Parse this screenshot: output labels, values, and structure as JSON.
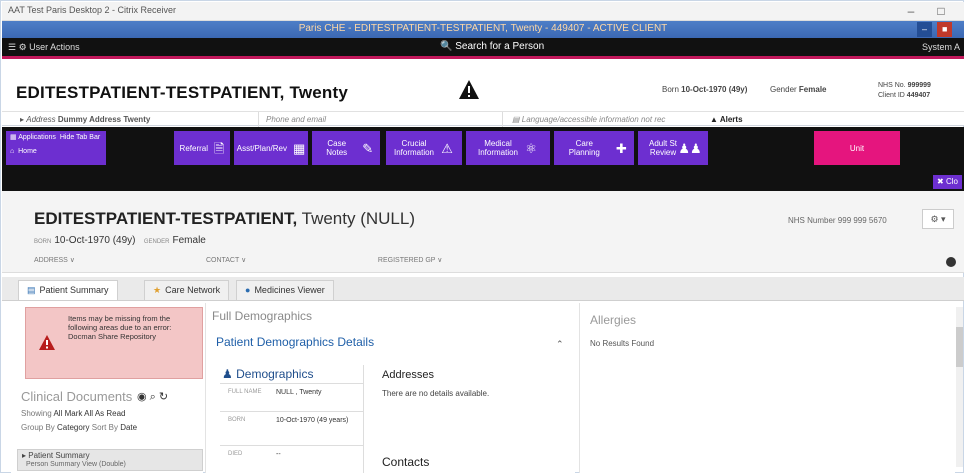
{
  "window": {
    "title": "AAT Test Paris Desktop 2 - Citrix Receiver",
    "minimize": "–",
    "maximize": "□"
  },
  "appbar": {
    "title": "Paris CHE - EDITESTPATIENT-TESTPATIENT, Twenty - 449407 - ACTIVE CLIENT",
    "ctl1": "–",
    "ctl2": "■"
  },
  "actions": {
    "user_actions": "User Actions",
    "search": "Search for a Person",
    "system": "System A"
  },
  "banner": {
    "name": "EDITESTPATIENT-TESTPATIENT, Twenty",
    "born_label": "Born",
    "born": "10-Oct-1970 (49y)",
    "gender_label": "Gender",
    "gender": "Female",
    "nhs_label": "NHS No.",
    "nhs": "999999",
    "client_label": "Client ID",
    "client": "449407",
    "address_label": "Address",
    "address": "Dummy Address Twenty",
    "phone": "Phone and email",
    "language": "Language/accessible information not rec",
    "alerts": "Alerts"
  },
  "toolbar": {
    "applications": "Applications",
    "hide_bar": "Hide Tab Bar",
    "home": "Home",
    "items": [
      {
        "label": "Referral",
        "icon": "document-arrow-icon"
      },
      {
        "label": "Asst/Plan/Rev",
        "icon": "calculator-icon"
      },
      {
        "label": "Case Notes",
        "icon": "notepad-icon"
      },
      {
        "label": "Crucial\nInformation",
        "icon": "warning-icon"
      },
      {
        "label": "Medical\nInformation",
        "icon": "pills-icon"
      },
      {
        "label": "Care Planning",
        "icon": "puzzle-icon"
      },
      {
        "label": "Adult St\nReview",
        "icon": "people-icon"
      },
      {
        "label": "Unit",
        "icon": ""
      }
    ],
    "close": "Clo"
  },
  "patient": {
    "name_bold": "EDITESTPATIENT-TESTPATIENT,",
    "name_rest": " Twenty (NULL)",
    "born_label": "BORN",
    "born": "10-Oct-1970 (49y)",
    "gender_label": "GENDER",
    "gender": "Female",
    "nhs": "NHS Number  999 999 5670",
    "gear": "⚙ ▾",
    "address_link": "ADDRESS ∨",
    "contact_link": "CONTACT ∨",
    "registered_link": "REGISTERED GP ∨"
  },
  "tabs": [
    {
      "label": "Patient Summary",
      "icon": "chart-icon"
    },
    {
      "label": "Care Network",
      "icon": "network-icon"
    },
    {
      "label": "Medicines Viewer",
      "icon": "pill-icon"
    }
  ],
  "left": {
    "alert_text": "Items may be missing from the following areas due to an error: Docman Share Repository",
    "clinical_docs": "Clinical Documents",
    "icons": "◉  ⌕  ↻",
    "showing_label": "Showing",
    "showing_all": "All",
    "mark_all": "Mark All As Read",
    "group_label": "Group By",
    "group_value": "Category",
    "sort_label": "Sort By",
    "sort_value": "Date",
    "summary_item": "Patient Summary",
    "summary_sub": "Person Summary View (Double)"
  },
  "middle": {
    "full_demographics": "Full Demographics",
    "details_title": "Patient Demographics Details",
    "demographics": "Demographics",
    "rows": [
      {
        "key": "FULL NAME",
        "value": "NULL , Twenty"
      },
      {
        "key": "BORN",
        "value": "10-Oct-1970 (49 years)"
      },
      {
        "key": "DIED",
        "value": "--"
      }
    ],
    "addresses": "Addresses",
    "no_details": "There are no details available.",
    "contacts": "Contacts"
  },
  "right": {
    "allergies": "Allergies",
    "no_results": "No Results Found"
  }
}
